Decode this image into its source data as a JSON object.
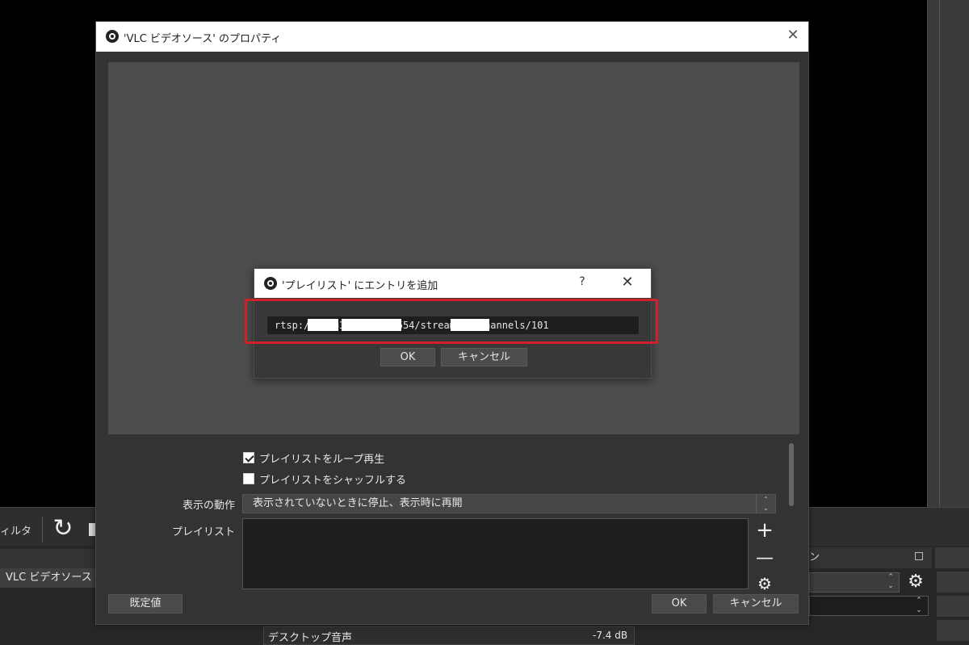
{
  "background": {
    "toolbar_filter_label": "ィルタ",
    "refresh_glyph": "↻",
    "sources": [
      {
        "label": "VLC ビデオソース"
      }
    ],
    "right_dock_title": "ン",
    "mixer": {
      "track_name": "デスクトップ音声",
      "level": "-7.4 dB"
    }
  },
  "properties_dialog": {
    "title": "'VLC ビデオソース' のプロパティ",
    "loop_playlist": {
      "label": "プレイリストをループ再生",
      "checked": true
    },
    "shuffle_playlist": {
      "label": "プレイリストをシャッフルする",
      "checked": false
    },
    "behavior": {
      "label": "表示の動作",
      "value": "表示されていないときに停止、表示時に再開"
    },
    "playlist": {
      "label": "プレイリスト",
      "add_glyph": "+",
      "remove_glyph": "—",
      "config_glyph": "⚙"
    },
    "defaults_button": "既定値",
    "ok_button": "OK",
    "cancel_button": "キャンセル",
    "close_glyph": "✕"
  },
  "add_entry_dialog": {
    "title": "'プレイリスト' にエントリを追加",
    "help_glyph": "?",
    "close_glyph": "✕",
    "url_value": "rtsp://      :          @192.168.      :554/streaming/channels/101",
    "ok_button": "OK",
    "cancel_button": "キャンセル",
    "highlight_color": "#d0202c"
  }
}
